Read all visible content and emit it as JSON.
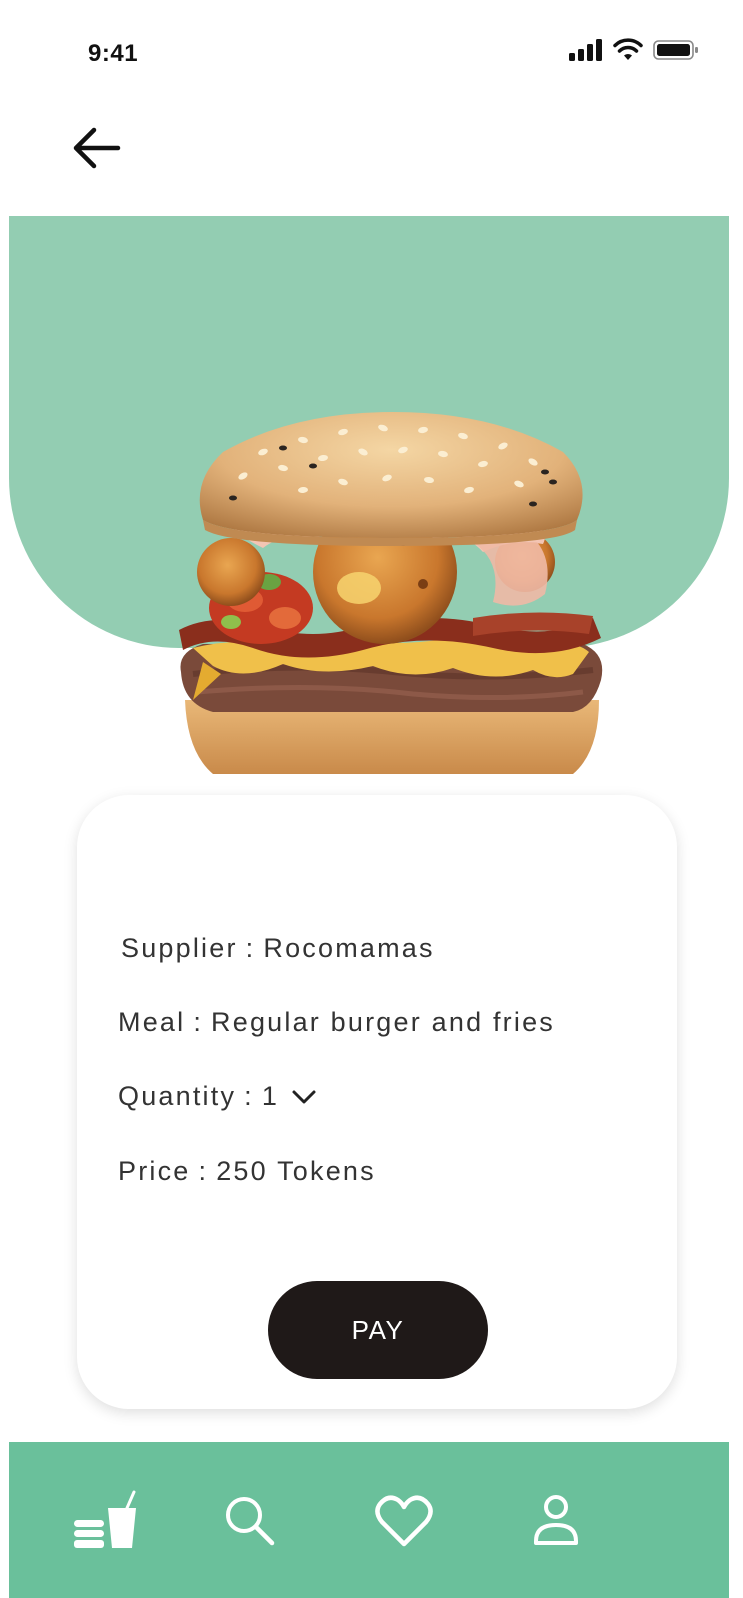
{
  "status_bar": {
    "time": "9:41"
  },
  "hero": {
    "image": "burger-image",
    "background_color": "#93cdb2"
  },
  "details": {
    "supplier_label": "Supplier",
    "supplier_value": "Rocomamas",
    "meal_label": "Meal",
    "meal_value": "Regular burger and fries",
    "quantity_label": "Quantity",
    "quantity_value": "1",
    "price_label": "Price",
    "price_value": "250 Tokens",
    "separator": ":"
  },
  "actions": {
    "pay_label": "PAY"
  },
  "bottom_nav": {
    "background_color": "#6ac09b",
    "items": [
      {
        "icon": "food-drink-icon"
      },
      {
        "icon": "search-icon"
      },
      {
        "icon": "heart-icon"
      },
      {
        "icon": "profile-icon"
      }
    ]
  }
}
